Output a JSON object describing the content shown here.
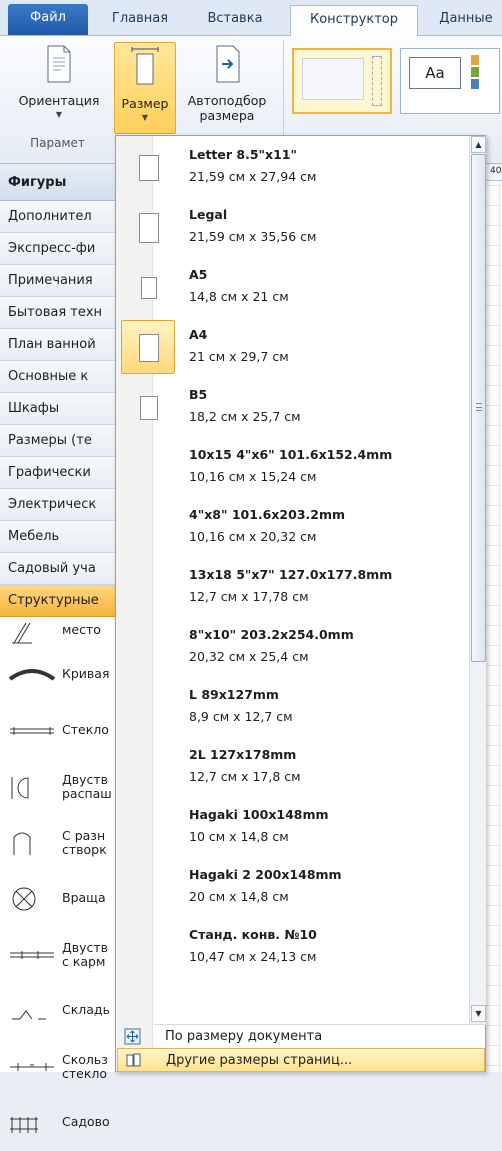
{
  "tabs": [
    "Файл",
    "Главная",
    "Вставка",
    "Конструктор",
    "Данные"
  ],
  "ribbon": {
    "orientation_label": "Ориентация",
    "size_label": "Размер",
    "autofit_label_1": "Автоподбор",
    "autofit_label_2": "размера",
    "group_label": "Парамет",
    "theme_text": "Aa"
  },
  "shapes_pane": {
    "title": "Фигуры",
    "stencils": [
      "Дополнител",
      "Экспресс-фи",
      "Примечания",
      "Бытовая техн",
      "План ванной",
      "Основные к",
      "Шкафы",
      "Размеры (те",
      "Графически",
      "Электрическ",
      "Мебель",
      "Садовый уча",
      "Структурные"
    ],
    "shapes": [
      {
        "label": "место",
        "icon": "wall-corner-icon"
      },
      {
        "label": "Кривая",
        "icon": "curved-wall-icon"
      },
      {
        "label": "Стекло",
        "icon": "glass-window-icon"
      },
      {
        "label": "Двуств\nраспаш",
        "icon": "double-door-icon"
      },
      {
        "label": "С разн\nстворк",
        "icon": "uneven-door-icon"
      },
      {
        "label": "Враща",
        "icon": "revolving-door-icon"
      },
      {
        "label": "Двуств\nс карм",
        "icon": "pocket-door-icon"
      },
      {
        "label": "Складь",
        "icon": "folding-door-icon"
      },
      {
        "label": "Скольз\nстекло",
        "icon": "sliding-glass-icon"
      },
      {
        "label": "Садово",
        "icon": "garden-fence-icon"
      }
    ]
  },
  "size_menu": {
    "items": [
      {
        "name": "Letter 8.5\"x11\"",
        "dims": "21,59 см x 27,94 см",
        "selected": false
      },
      {
        "name": "Legal",
        "dims": "21,59 см x 35,56 см",
        "selected": false
      },
      {
        "name": "A5",
        "dims": "14,8 см x 21 см",
        "selected": false
      },
      {
        "name": "A4",
        "dims": "21 см x 29,7 см",
        "selected": true
      },
      {
        "name": "B5",
        "dims": "18,2 см x 25,7 см",
        "selected": false
      },
      {
        "name": "10x15 4\"x6\" 101.6x152.4mm",
        "dims": "10,16 см x 15,24 см",
        "selected": false
      },
      {
        "name": "4\"x8\" 101.6x203.2mm",
        "dims": "10,16 см x 20,32 см",
        "selected": false
      },
      {
        "name": "13x18 5\"x7\" 127.0x177.8mm",
        "dims": "12,7 см x 17,78 см",
        "selected": false
      },
      {
        "name": "8\"x10\" 203.2x254.0mm",
        "dims": "20,32 см x 25,4 см",
        "selected": false
      },
      {
        "name": "L 89x127mm",
        "dims": "8,9 см x 12,7 см",
        "selected": false
      },
      {
        "name": "2L 127x178mm",
        "dims": "12,7 см x 17,8 см",
        "selected": false
      },
      {
        "name": "Hagaki 100x148mm",
        "dims": "10 см x 14,8 см",
        "selected": false
      },
      {
        "name": "Hagaki 2 200x148mm",
        "dims": "20 см x 14,8 см",
        "selected": false
      },
      {
        "name": "Станд. конв. №10",
        "dims": "10,47 см x 24,13 см",
        "selected": false
      }
    ],
    "fit_to_document": "По размеру документа",
    "more_sizes": "Другие размеры страниц..."
  },
  "ruler_value": "40",
  "colors": {
    "accent": "#ffd77a",
    "file_tab": "#2a6bbb"
  }
}
